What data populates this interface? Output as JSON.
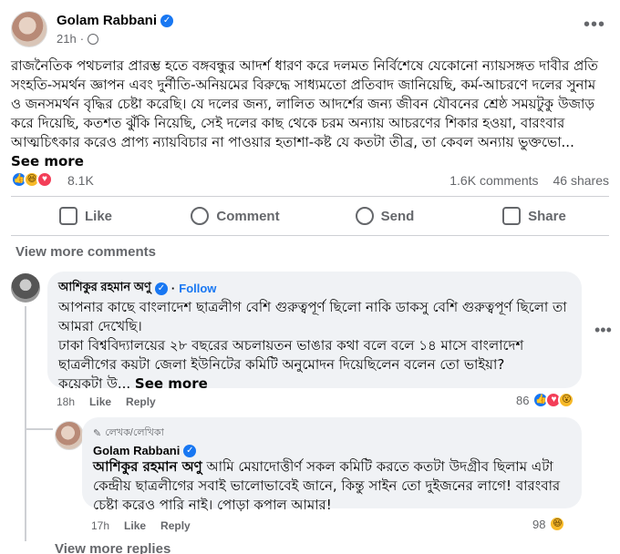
{
  "post": {
    "author": "Golam Rabbani",
    "time": "21h",
    "dot": "·",
    "privacy_icon": "globe-icon",
    "text": "রাজনৈতিক পথচলার প্রারম্ভ হতে বঙ্গবন্ধুর আদর্শ ধারণ করে দলমত নির্বিশেষে যেকোনো ন্যায়সঙ্গত দাবীর প্রতি সংহতি-সমর্থন জ্ঞাপন এবং দুর্নীতি-অনিয়মের বিরুদ্ধে সাধ্যমতো প্রতিবাদ জানিয়েছি, কর্ম-আচরণে দলের সুনাম ও জনসমর্থন বৃদ্ধির চেষ্টা করেছি। যে দলের জন্য, লালিত আদর্শের জন্য জীবন যৌবনের শ্রেষ্ঠ সময়টুকু উজাড় করে দিয়েছি, কতশত ঝুঁকি নিয়েছি, সেই দলের কাছ থেকে চরম অন্যায় আচরণের শিকার হওয়া, বারংবার আত্মচিৎকার করেও প্রাপ্য ন্যায়বিচার না পাওয়ার হতাশা-কষ্ট যে কতটা তীব্র, তা কেবল অন্যায় ভুক্তভো...",
    "see_more": "See more",
    "reaction_count": "8.1K",
    "comments_count": "1.6K comments",
    "shares_count": "46 shares"
  },
  "actions": {
    "like": "Like",
    "comment": "Comment",
    "send": "Send",
    "share": "Share"
  },
  "view_more_comments": "View more comments",
  "comment1": {
    "author": "আশিকুর রহমান অণু",
    "follow": "Follow",
    "text": "আপনার কাছে বাংলাদেশ ছাত্রলীগ বেশি গুরুত্বপূর্ণ ছিলো নাকি ডাকসু বেশি গুরুত্বপূর্ণ ছিলো তা আমরা দেখেছি।",
    "text2": "ঢাকা বিশ্ববিদ্যালয়ের ২৮ বছরের অচলায়তন ভাঙার কথা বলে বলে ১৪ মাসে বাংলাদেশ ছাত্রলীগের কয়টা জেলা ইউনিটের কমিটি অনুমোদন দিয়েছিলেন বলেন তো ভাইয়া?",
    "text3": "কয়েকটা উ...",
    "see_more": "See more",
    "time": "18h",
    "like": "Like",
    "reply": "Reply",
    "reactions": "86"
  },
  "reply1": {
    "author_tag": "লেখক/লেখিকা",
    "author": "Golam Rabbani",
    "mention": "আশিকুর রহমান অণু",
    "text": "আমি মেয়াদোত্তীর্ণ সকল কমিটি করতে কতটা উদগ্রীব ছিলাম এটা কেন্দ্রীয় ছাত্রলীগের সবাই ভালোভাবেই জানে, কিন্তু সাইন তো দুইজনের লাগে! বারংবার চেষ্টা করেও পারি নাই। পোড়া কপাল আমার!",
    "time": "17h",
    "like": "Like",
    "reply": "Reply",
    "reactions": "98"
  },
  "view_more_replies": "View more replies",
  "colors": {
    "accent": "#1877f2",
    "secondary_text": "#65676b",
    "bubble": "#f0f2f5"
  }
}
